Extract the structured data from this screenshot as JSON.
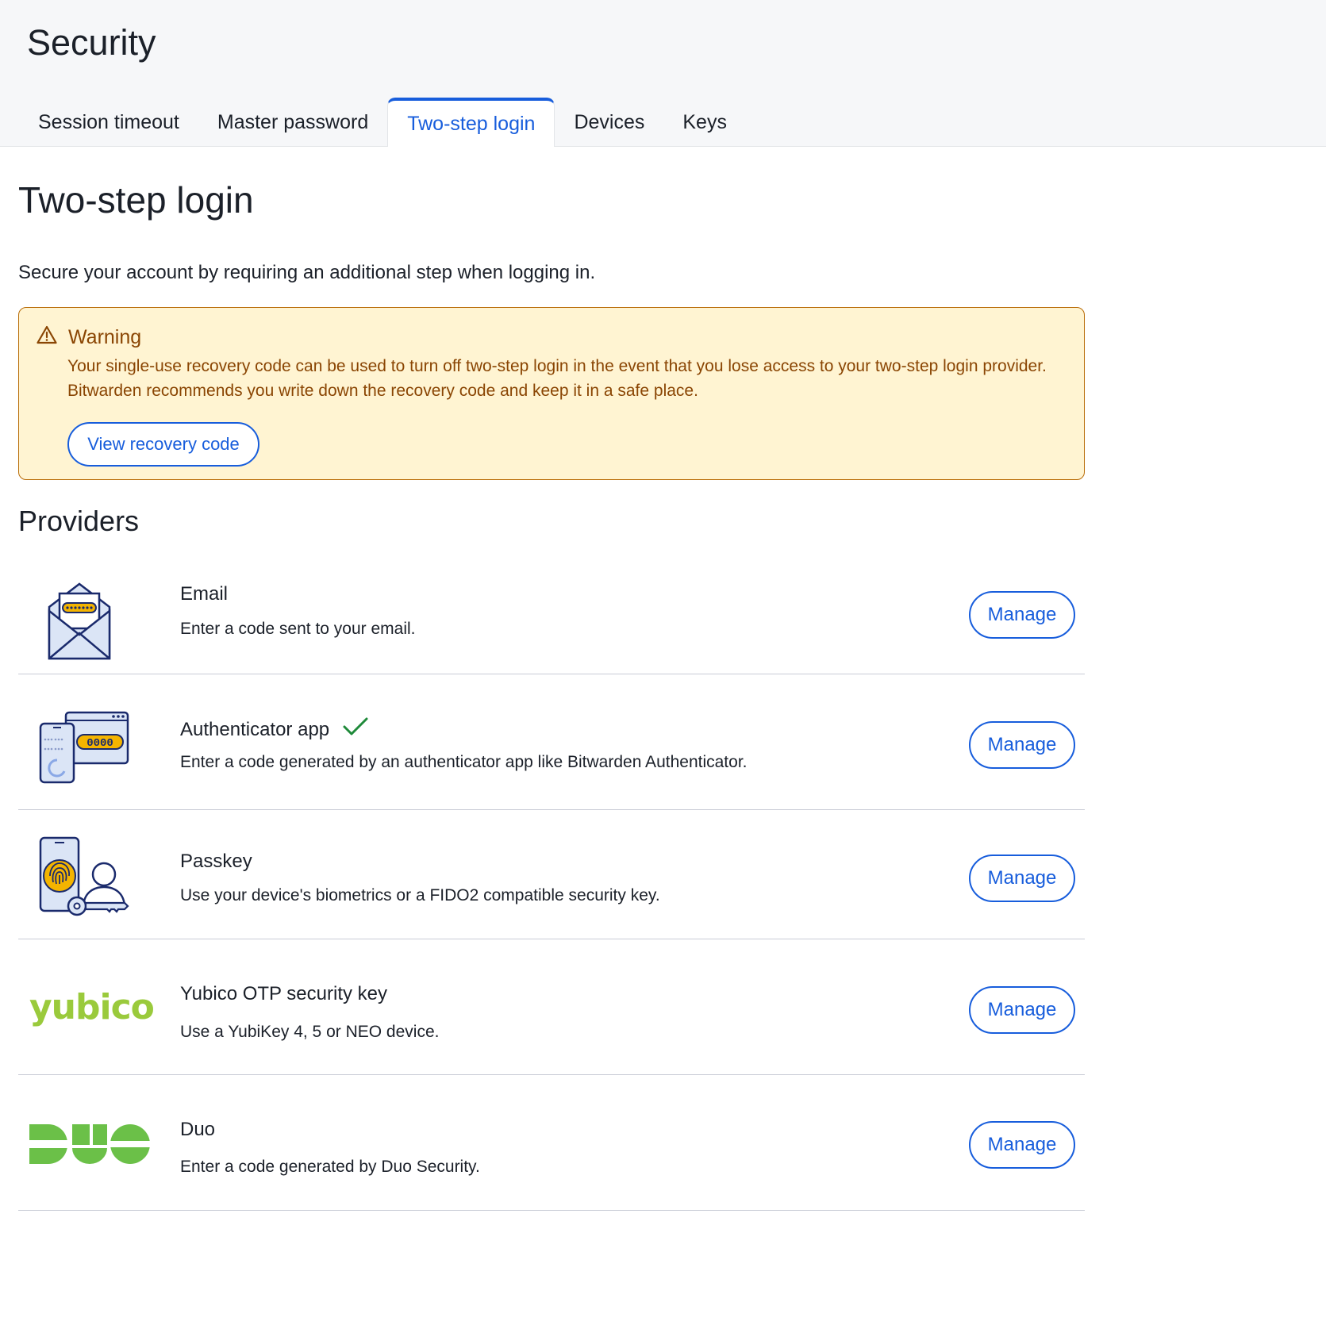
{
  "header": {
    "title": "Security",
    "tabs": [
      {
        "label": "Session timeout",
        "active": false
      },
      {
        "label": "Master password",
        "active": false
      },
      {
        "label": "Two-step login",
        "active": true
      },
      {
        "label": "Devices",
        "active": false
      },
      {
        "label": "Keys",
        "active": false
      }
    ]
  },
  "main": {
    "title": "Two-step login",
    "intro": "Secure your account by requiring an additional step when logging in.",
    "warning": {
      "icon": "warning-triangle-icon",
      "title": "Warning",
      "body": "Your single-use recovery code can be used to turn off two-step login in the event that you lose access to your two-step login provider. Bitwarden recommends you write down the recovery code and keep it in a safe place.",
      "button_label": "View recovery code"
    },
    "providers_title": "Providers",
    "providers": [
      {
        "name": "Email",
        "description": "Enter a code sent to your email.",
        "icon": "email-envelope-icon",
        "enabled": false,
        "button_label": "Manage"
      },
      {
        "name": "Authenticator app",
        "description": "Enter a code generated by an authenticator app like Bitwarden Authenticator.",
        "icon": "authenticator-app-icon",
        "enabled": true,
        "button_label": "Manage"
      },
      {
        "name": "Passkey",
        "description": "Use your device's biometrics or a FIDO2 compatible security key.",
        "icon": "passkey-fingerprint-icon",
        "enabled": false,
        "button_label": "Manage"
      },
      {
        "name": "Yubico OTP security key",
        "description": "Use a YubiKey 4, 5 or NEO device.",
        "icon": "yubico-logo",
        "enabled": false,
        "button_label": "Manage"
      },
      {
        "name": "Duo",
        "description": "Enter a code generated by Duo Security.",
        "icon": "duo-logo",
        "enabled": false,
        "button_label": "Manage"
      }
    ]
  },
  "colors": {
    "accent": "#175ddc",
    "warning_bg": "#fff4d2",
    "warning_text": "#8a4503",
    "success": "#1f8a3a",
    "yubico_green": "#9aca3c",
    "duo_green": "#6bc048"
  }
}
